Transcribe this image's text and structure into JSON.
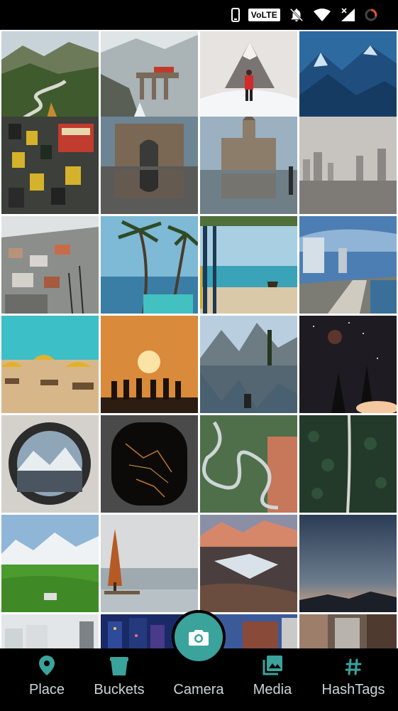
{
  "status_bar": {
    "network_badge": "VoLTE",
    "icons": [
      "phone-icon",
      "volte-badge",
      "mute-icon",
      "wifi-icon",
      "signal-icon",
      "battery-icon"
    ]
  },
  "gallery": {
    "tiles": [
      {
        "subject": "mountain road"
      },
      {
        "subject": "snowy rail bridge"
      },
      {
        "subject": "hiker and snowy peak"
      },
      {
        "subject": "blue mountains"
      },
      {
        "subject": "traffic street"
      },
      {
        "subject": "gateway monument"
      },
      {
        "subject": "heritage building reflection"
      },
      {
        "subject": "hazy city skyline"
      },
      {
        "subject": "hillside town"
      },
      {
        "subject": "palm beach"
      },
      {
        "subject": "seaside promenade"
      },
      {
        "subject": "coastal road"
      },
      {
        "subject": "beach umbrellas"
      },
      {
        "subject": "sunset silhouettes"
      },
      {
        "subject": "mountain lake reflection"
      },
      {
        "subject": "starry night sky"
      },
      {
        "subject": "camera lens mountain"
      },
      {
        "subject": "plane window night city"
      },
      {
        "subject": "winding road aerial"
      },
      {
        "subject": "forest road aerial"
      },
      {
        "subject": "green alpine valley"
      },
      {
        "subject": "autumn tree lake"
      },
      {
        "subject": "sunrise snowy lake"
      },
      {
        "subject": "dusk horizon"
      },
      {
        "subject": "city buildings"
      },
      {
        "subject": "neon city night"
      },
      {
        "subject": "blue facade"
      },
      {
        "subject": "misty brick street"
      }
    ]
  },
  "bottom_nav": {
    "accent_color": "#3aa39b",
    "items": [
      {
        "label": "Place",
        "icon": "location-pin-icon"
      },
      {
        "label": "Buckets",
        "icon": "bucket-icon"
      },
      {
        "label": "Camera",
        "icon": "camera-icon"
      },
      {
        "label": "Media",
        "icon": "photo-library-icon"
      },
      {
        "label": "HashTags",
        "icon": "hashtag-icon"
      }
    ]
  }
}
